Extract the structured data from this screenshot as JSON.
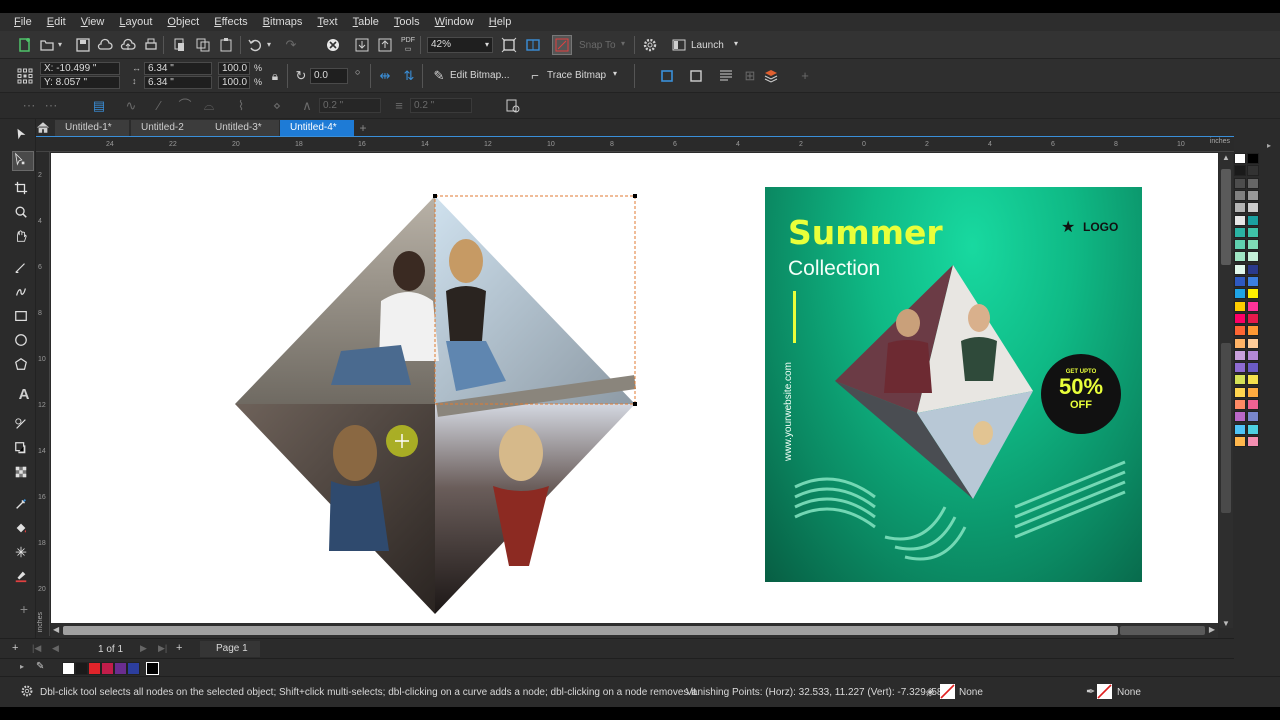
{
  "menu": [
    "File",
    "Edit",
    "View",
    "Layout",
    "Object",
    "Effects",
    "Bitmaps",
    "Text",
    "Table",
    "Tools",
    "Window",
    "Help"
  ],
  "standard_toolbar": {
    "zoom_value": "42%",
    "snap_to_label": "Snap To",
    "launch_label": "Launch"
  },
  "property_bar": {
    "x_value": "X: -10.499 \"",
    "y_value": "Y: 8.057 \"",
    "width_value": "6.34 \"",
    "height_value": "6.34 \"",
    "scale_w": "100.0",
    "scale_h": "100.0",
    "percent_sign": "%",
    "rotation_value": "0.0",
    "edit_bitmap_label": "Edit Bitmap...",
    "trace_bitmap_label": "Trace Bitmap"
  },
  "property_bar2": {
    "field1": "0.2 \"",
    "field2": "0.2 \""
  },
  "tabs": [
    {
      "label": "Untitled-1*",
      "active": false
    },
    {
      "label": "Untitled-2",
      "active": false
    },
    {
      "label": "Untitled-3*",
      "active": false
    },
    {
      "label": "Untitled-4*",
      "active": true
    }
  ],
  "ruler": {
    "unit": "inches",
    "h_ticks": [
      "24",
      "22",
      "20",
      "18",
      "16",
      "14",
      "12",
      "10",
      "8",
      "6",
      "4",
      "2",
      "0",
      "2",
      "4",
      "6",
      "8",
      "10"
    ],
    "v_ticks": [
      "2",
      "4",
      "6",
      "8",
      "10",
      "12",
      "14",
      "16",
      "18",
      "20"
    ]
  },
  "poster": {
    "title": "Summer",
    "subtitle": "Collection",
    "logo": "LOGO",
    "website": "www.yourwebsite.com",
    "badge_top": "GET UPTO",
    "badge_percent": "50%",
    "badge_off": "OFF"
  },
  "page_bar": {
    "page_count": "1 of 1",
    "page_tab": "Page 1"
  },
  "status": {
    "hint": "Dbl-click tool selects all nodes on the selected object; Shift+click multi-selects; dbl-clicking on a curve adds a node; dbl-clicking on a node removes it",
    "vanishing": "Vanishing Points: (Horz): 32.533, 11.227  (Vert): -7.329, 58.",
    "fill_none": "None",
    "outline_none": "None"
  },
  "colors": {
    "accent": "#1e7bd6",
    "poster_green": "#0fb985",
    "poster_yellow": "#e9ff3a",
    "palette": [
      "#ffffff",
      "#000000",
      "#1a1a1a",
      "#333333",
      "#4d4d4d",
      "#666666",
      "#808080",
      "#999999",
      "#b3b3b3",
      "#cccccc",
      "#e6e6e6",
      "#1aa0a0",
      "#2ab3a3",
      "#3fc2a8",
      "#5fd0ae",
      "#7fdcb6",
      "#a0e6c4",
      "#c4f0d8",
      "#e2f8ec",
      "#2b3a8c",
      "#2e59c1",
      "#3b7fe0",
      "#1fa4e6",
      "#ffee00",
      "#ffcc00",
      "#ff3399",
      "#ff0066",
      "#e6194b",
      "#ff6633",
      "#ff9933",
      "#ffb366",
      "#ffcc99",
      "#c9a0dc",
      "#b388d6",
      "#8e6bd1",
      "#6b5bc4",
      "#d4e157",
      "#f4e04d",
      "#ffd54f",
      "#ffab40",
      "#ff8a65",
      "#f06292",
      "#ba68c8",
      "#7986cb",
      "#4fc3f7",
      "#4dd0e1",
      "#ffb74d",
      "#f48fb1"
    ],
    "doc_palette": [
      "#ffffff",
      "#1a1a1a",
      "#e0242a",
      "#c21d4a",
      "#6a2d8f",
      "#2c3e9e",
      "#000000"
    ]
  }
}
